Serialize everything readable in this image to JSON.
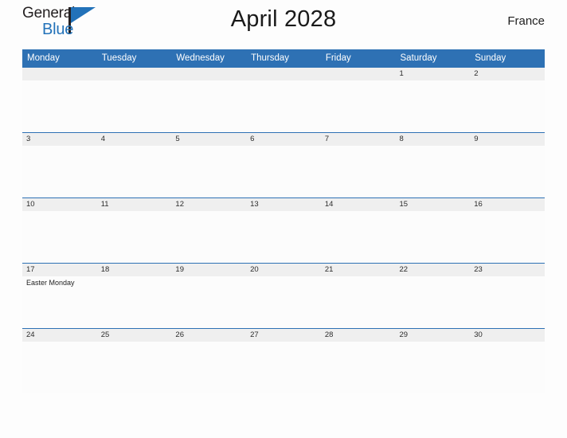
{
  "brand": {
    "word_one": "General",
    "word_two": "Blue",
    "accent_color": "#2272b9",
    "triangle_icon": "triangle-right-icon"
  },
  "header": {
    "title": "April 2028",
    "country": "France"
  },
  "calendar": {
    "header_color": "#2e71b4",
    "strip_color": "#efefef",
    "weekday_headers": [
      "Monday",
      "Tuesday",
      "Wednesday",
      "Thursday",
      "Friday",
      "Saturday",
      "Sunday"
    ],
    "weeks": [
      [
        {
          "day": "",
          "events": []
        },
        {
          "day": "",
          "events": []
        },
        {
          "day": "",
          "events": []
        },
        {
          "day": "",
          "events": []
        },
        {
          "day": "",
          "events": []
        },
        {
          "day": "1",
          "events": []
        },
        {
          "day": "2",
          "events": []
        }
      ],
      [
        {
          "day": "3",
          "events": []
        },
        {
          "day": "4",
          "events": []
        },
        {
          "day": "5",
          "events": []
        },
        {
          "day": "6",
          "events": []
        },
        {
          "day": "7",
          "events": []
        },
        {
          "day": "8",
          "events": []
        },
        {
          "day": "9",
          "events": []
        }
      ],
      [
        {
          "day": "10",
          "events": []
        },
        {
          "day": "11",
          "events": []
        },
        {
          "day": "12",
          "events": []
        },
        {
          "day": "13",
          "events": []
        },
        {
          "day": "14",
          "events": []
        },
        {
          "day": "15",
          "events": []
        },
        {
          "day": "16",
          "events": []
        }
      ],
      [
        {
          "day": "17",
          "events": [
            "Easter Monday"
          ]
        },
        {
          "day": "18",
          "events": []
        },
        {
          "day": "19",
          "events": []
        },
        {
          "day": "20",
          "events": []
        },
        {
          "day": "21",
          "events": []
        },
        {
          "day": "22",
          "events": []
        },
        {
          "day": "23",
          "events": []
        }
      ],
      [
        {
          "day": "24",
          "events": []
        },
        {
          "day": "25",
          "events": []
        },
        {
          "day": "26",
          "events": []
        },
        {
          "day": "27",
          "events": []
        },
        {
          "day": "28",
          "events": []
        },
        {
          "day": "29",
          "events": []
        },
        {
          "day": "30",
          "events": []
        }
      ]
    ]
  }
}
